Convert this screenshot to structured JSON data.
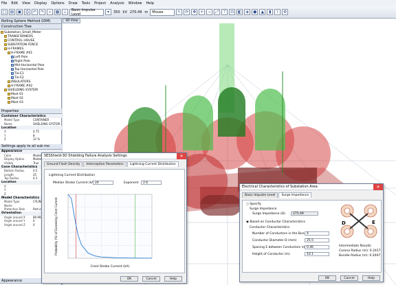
{
  "menu": [
    "File",
    "Edit",
    "View",
    "Display",
    "Options",
    "Draw",
    "Tools",
    "Project",
    "Analysis",
    "Window",
    "Help"
  ],
  "toolbar": {
    "left_label": "Rolling Sphere Method (IDM)",
    "level": "Basic Impulse Level",
    "bil_value": "350",
    "bil_unit": "kV",
    "mouse_coord": "270.49",
    "mouse_unit": "m",
    "mode": "Mouse"
  },
  "tree": {
    "title": "Construction Tree",
    "items": [
      {
        "label": "Substation_Small_Meter",
        "indent": 0
      },
      {
        "label": "TRANSFORMERS",
        "indent": 1
      },
      {
        "label": "CONTROL HOUSE",
        "indent": 1
      },
      {
        "label": "SUBSTATION FENCE",
        "indent": 1
      },
      {
        "label": "H-FRAMES",
        "indent": 1
      },
      {
        "label": "H-FRAME #01",
        "indent": 2
      },
      {
        "label": "Left Pole",
        "indent": 3
      },
      {
        "label": "Right Pole",
        "indent": 3
      },
      {
        "label": "Mid-Horizontal Pole",
        "indent": 3
      },
      {
        "label": "Top Horizontal Pole",
        "indent": 3
      },
      {
        "label": "Tie E1",
        "indent": 3
      },
      {
        "label": "Tie E2",
        "indent": 3
      },
      {
        "label": "INSULATORS",
        "indent": 2
      },
      {
        "label": "H-FRAME #02",
        "indent": 2
      },
      {
        "label": "SHIELDING SYSTEM",
        "indent": 1
      },
      {
        "label": "Mast 01",
        "indent": 2
      },
      {
        "label": "Mast 02",
        "indent": 2
      },
      {
        "label": "Mast 03",
        "indent": 2
      }
    ]
  },
  "properties": {
    "title": "Properties",
    "container_head": "Container Characteristics",
    "container_rows": [
      {
        "k": "Model Type",
        "v": "CONTAINER"
      },
      {
        "k": "Name",
        "v": "SHIELDING SYSTEM"
      }
    ],
    "location_head": "Location",
    "location_rows": [
      {
        "k": "X",
        "v": "4.75"
      },
      {
        "k": "Y",
        "v": "8"
      },
      {
        "k": "Z",
        "v": "12 %"
      }
    ],
    "settings_line": "Settings apply to all sub mo",
    "appearance_head": "Appearance",
    "appearance_rows": [
      {
        "k": "Color",
        "v": "Model"
      },
      {
        "k": "Display Option",
        "v": "Model"
      },
      {
        "k": "Visible",
        "v": "True"
      }
    ],
    "cone_head": "Cone Characteristics",
    "cone_rows": [
      {
        "k": "Bottom Radius",
        "v": "0.5"
      },
      {
        "k": "Length",
        "v": "25"
      },
      {
        "k": "Top Radius",
        "v": "0.1"
      }
    ],
    "loc2_head": "Location",
    "loc2_rows": [
      {
        "k": "X",
        "v": ""
      },
      {
        "k": "Y",
        "v": ""
      },
      {
        "k": "Z",
        "v": ""
      }
    ],
    "model_head": "Model Characteristics",
    "model_rows": [
      {
        "k": "Model Type",
        "v": "CYLIND"
      },
      {
        "k": "Name",
        "v": ""
      },
      {
        "k": "Protection Role",
        "v": "Part of"
      }
    ],
    "orient_head": "Orientation",
    "orient_rows": [
      {
        "k": "Angle around X",
        "v": "89.995"
      },
      {
        "k": "Angle around Y",
        "v": "0"
      },
      {
        "k": "Angle around Z",
        "v": "0"
      }
    ],
    "bottom_label": "Appearance"
  },
  "viewport": {
    "tab": "3D View"
  },
  "dialog1": {
    "title": "SESShield-3D Shielding Failure Analysis Settings",
    "tabs": [
      "Ground Flash Density",
      "Interception Parameters",
      "Lightning Current Distribution"
    ],
    "group": "Lightning Current Distribution",
    "median_label": "Median Stroke Current (kA)",
    "median_value": "24",
    "exponent_label": "Exponent",
    "exponent_value": "2.6",
    "chart_xlabel": "Crest Stroke Current (kA)",
    "chart_ylabel": "Probability (%) of Exceeding Crest Current",
    "ok": "OK",
    "cancel": "Cancel",
    "help": "Help"
  },
  "dialog2": {
    "title": "Electrical Characteristics of Substation Area",
    "tabs": [
      "Basic Impulse Level",
      "Surge Impedance"
    ],
    "specify_label": "Specify",
    "surge_group": "Surge Impedance",
    "surge_label": "Surge Impedance (Ω)",
    "surge_value": "275.49",
    "based_label": "Based on Conductor Characteristics",
    "cond_group": "Conductor Characteristics",
    "rows": [
      {
        "k": "Number of Conductors in the Bundle",
        "v": "4"
      },
      {
        "k": "Conductor Diameter D (mm)",
        "v": "25.5"
      },
      {
        "k": "Spacing E between Conductors (m)",
        "v": "0.46"
      },
      {
        "k": "Height of Conductor (m)",
        "v": "10.1"
      }
    ],
    "results_head": "Intermediate Results",
    "corona": "Corona Radius (m): 0.2417",
    "bundle": "Bundle Radius (m): 0.2047",
    "label_d": "D",
    "label_e": "E",
    "ok": "OK",
    "cancel": "Cancel",
    "help": "Help"
  },
  "chart_data": {
    "type": "line",
    "title": "",
    "xlabel": "Crest Stroke Current (kA)",
    "ylabel": "Probability (%) of Exceeding Crest Current",
    "series": [
      {
        "x": [
          0,
          10,
          20,
          30,
          40,
          60,
          80,
          100,
          150,
          200,
          250
        ],
        "y": [
          100,
          93,
          62,
          36,
          21,
          8,
          3.5,
          1.8,
          0.6,
          0.2,
          0.1
        ]
      }
    ],
    "xlim": [
      0,
      250
    ],
    "ylim": [
      0,
      100
    ],
    "grid": true
  },
  "colors": {
    "green": "#4fbe4f",
    "red": "#d43a3a",
    "dark_red": "#7a2626",
    "accent": "#2d4f8e"
  }
}
